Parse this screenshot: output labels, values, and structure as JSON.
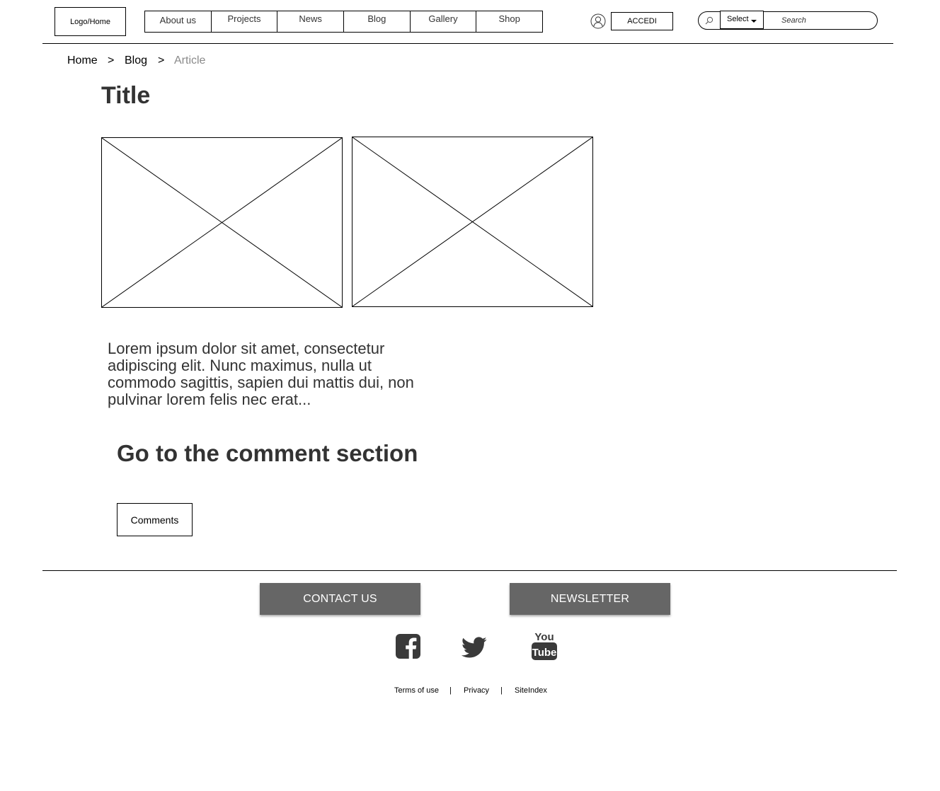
{
  "header": {
    "logo_label": "Logo/Home",
    "nav": [
      "About us",
      "Projects",
      "News",
      "Blog",
      "Gallery",
      "Shop"
    ],
    "login_label": "ACCEDI",
    "select_label": "Select",
    "search_placeholder": "Search"
  },
  "breadcrumb": {
    "home": "Home",
    "blog": "Blog",
    "current": "Article",
    "separator": ">"
  },
  "article": {
    "title": "Title",
    "body": "Lorem ipsum dolor sit amet, consectetur adipiscing elit. Nunc maximus, nulla ut commodo sagittis, sapien dui mattis dui, non pulvinar lorem felis nec erat...",
    "comment_heading": "Go to the comment section",
    "comments_button": "Comments"
  },
  "footer": {
    "contact_label": "CONTACT US",
    "newsletter_label": "NEWSLETTER",
    "social": [
      "facebook-icon",
      "twitter-icon",
      "youtube-icon"
    ],
    "youtube_top": "You",
    "youtube_bottom": "Tube",
    "links": [
      "Terms of use",
      "Privacy",
      "SiteIndex"
    ],
    "link_separator": "|"
  },
  "colors": {
    "footer_button_bg": "#666666",
    "text_dark": "#333333",
    "breadcrumb_current": "#8a8a8a"
  }
}
